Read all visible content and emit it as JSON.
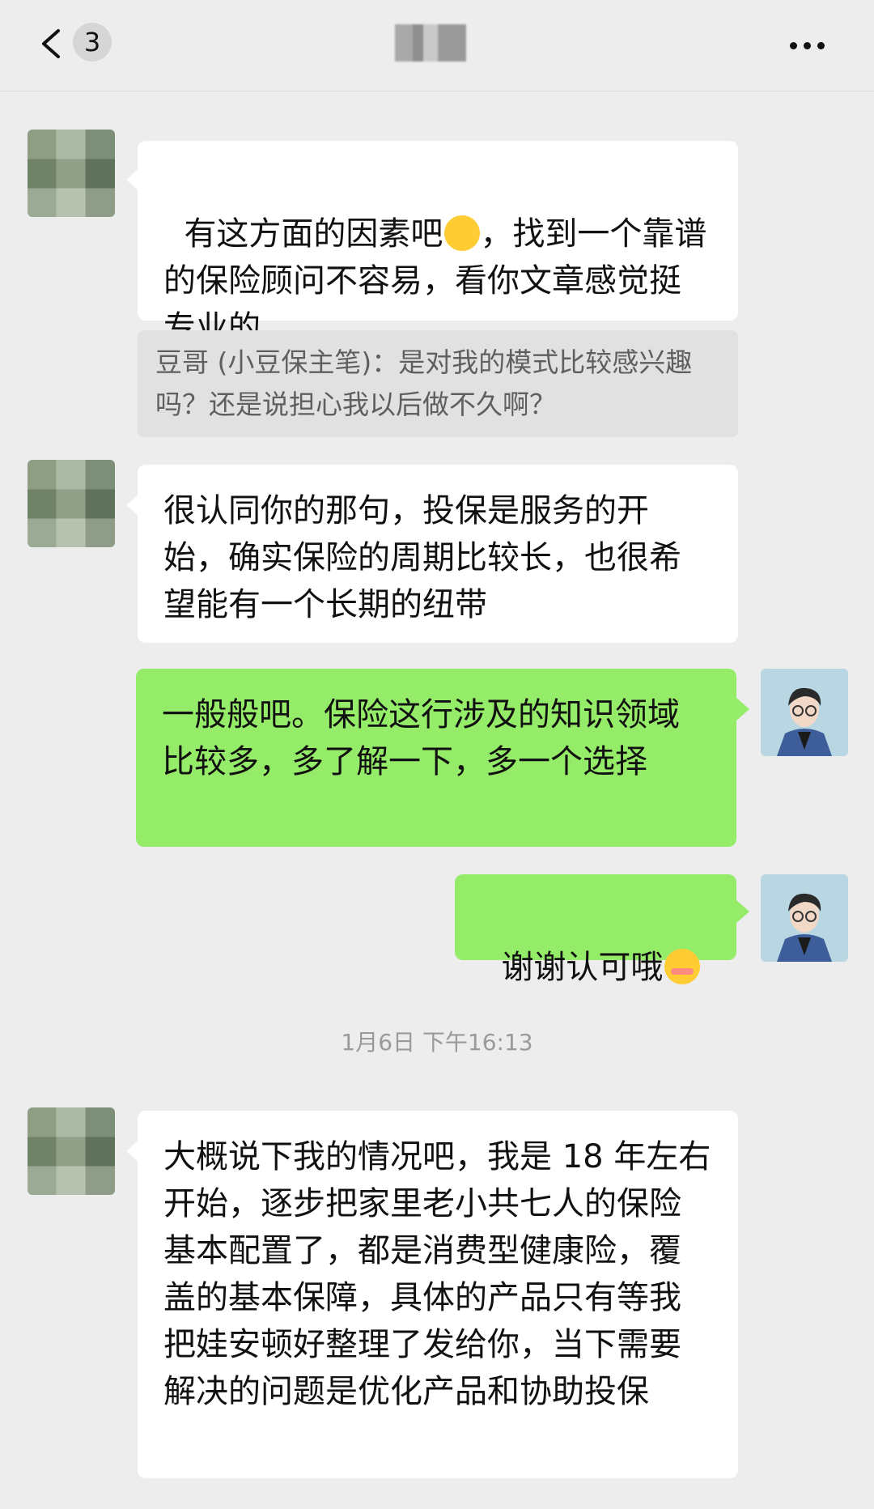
{
  "header": {
    "unread_count": "3"
  },
  "messages": {
    "m1": "有这方面的因素吧 ，找到一个靠谱的保险顾问不容易，看你文章感觉挺专业的",
    "m1a": "有这方面的因素吧",
    "m1b": "，找到一个靠谱的保险顾问不容易，看你文章感觉挺专业的",
    "quote": "豆哥 (小豆保主笔)：是对我的模式比较感兴趣吗？还是说担心我以后做不久啊？",
    "m2": "很认同你的那句，投保是服务的开始，确实保险的周期比较长，也很希望能有一个长期的纽带",
    "m3": "一般般吧。保险这行涉及的知识领域比较多，多了解一下，多一个选择",
    "m4": "谢谢认可哦",
    "timestamp": "1月6日 下午16:13",
    "m5": "大概说下我的情况吧，我是 18 年左右开始，逐步把家里老小共七人的保险基本配置了，都是消费型健康险，覆盖的基本保障，具体的产品只有等我把娃安顿好整理了发给你，当下需要解决的问题是优化产品和协助投保"
  },
  "icons": {
    "back": "chevron-left-icon",
    "more": "more-dots-icon",
    "emoji_thinking": "hand-over-mouth-emoji",
    "emoji_blush": "blushing-smile-emoji"
  },
  "colors": {
    "background": "#ededed",
    "incoming_bubble": "#ffffff",
    "outgoing_bubble": "#95ec69",
    "quote_bg": "#e1e1e1"
  }
}
